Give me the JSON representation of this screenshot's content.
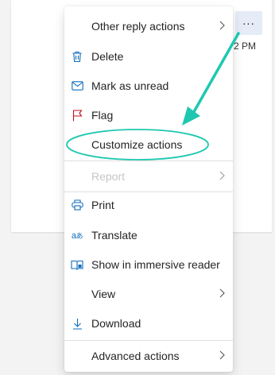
{
  "colors": {
    "accent": "#0f6cbd",
    "annotation": "#1fc7b0",
    "flag": "#c50f1f",
    "disabled": "#c8c6c4"
  },
  "message": {
    "time": "2 PM",
    "more_label": "..."
  },
  "menu": {
    "other_reply_actions": "Other reply actions",
    "delete": "Delete",
    "mark_as_unread": "Mark as unread",
    "flag": "Flag",
    "customize_actions": "Customize actions",
    "report": "Report",
    "print": "Print",
    "translate": "Translate",
    "immersive_reader": "Show in immersive reader",
    "view": "View",
    "download": "Download",
    "advanced_actions": "Advanced actions"
  },
  "icons": {
    "delete": "trash-icon",
    "mark_as_unread": "envelope-icon",
    "flag": "flag-icon",
    "print": "printer-icon",
    "translate": "translate-icon",
    "immersive_reader": "immersive-reader-icon",
    "download": "download-icon",
    "submenu": "chevron-right-icon"
  }
}
